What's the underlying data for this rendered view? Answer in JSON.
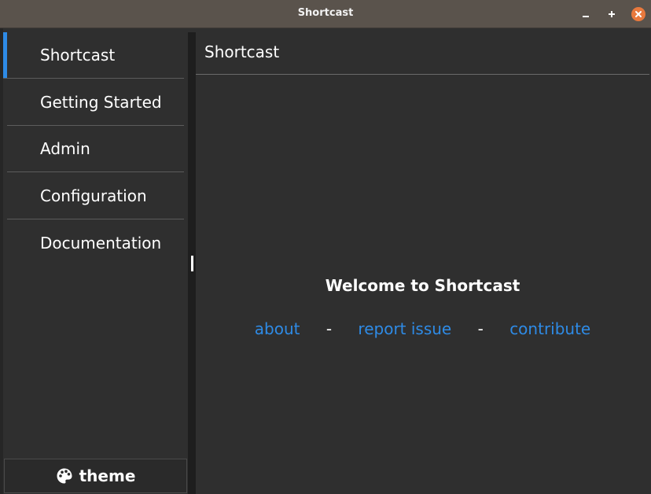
{
  "window": {
    "title": "Shortcast",
    "controls": {
      "minimize": "–",
      "maximize": "+",
      "close": "×"
    }
  },
  "sidebar": {
    "items": [
      {
        "label": "Shortcast",
        "active": true
      },
      {
        "label": "Getting Started"
      },
      {
        "label": "Admin"
      },
      {
        "label": "Configuration"
      },
      {
        "label": "Documentation"
      }
    ],
    "theme_button": {
      "label": "theme",
      "icon": "palette-icon"
    }
  },
  "content": {
    "header": "Shortcast",
    "welcome": "Welcome to Shortcast",
    "links": {
      "about": "about",
      "separator1": "-",
      "report_issue": "report issue",
      "separator2": "-",
      "contribute": "contribute"
    }
  },
  "colors": {
    "accent": "#2e8be6",
    "titlebar": "#5a534c",
    "background": "#2f2f2f",
    "close_button": "#e9793d"
  }
}
